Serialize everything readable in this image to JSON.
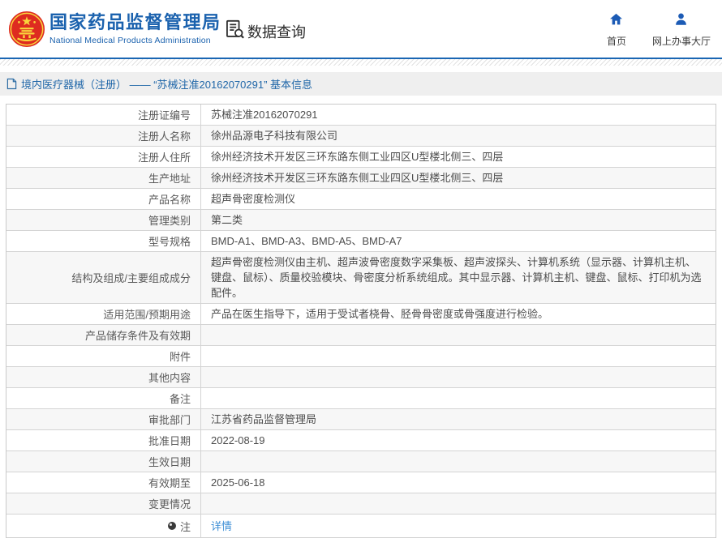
{
  "header": {
    "title_cn": "国家药品监督管理局",
    "title_en": "National Medical Products Administration",
    "section_label": "数据查询",
    "nav": [
      {
        "label": "首页",
        "icon": "home-icon"
      },
      {
        "label": "网上办事大厅",
        "icon": "user-icon"
      }
    ]
  },
  "breadcrumb": {
    "text": "境内医疗器械（注册） —— “苏械注准20162070291” 基本信息",
    "icon": "document-icon"
  },
  "table": {
    "rows": [
      {
        "label": "注册证编号",
        "value": "苏械注准20162070291"
      },
      {
        "label": "注册人名称",
        "value": "徐州品源电子科技有限公司"
      },
      {
        "label": "注册人住所",
        "value": "徐州经济技术开发区三环东路东侧工业四区U型楼北侧三、四层"
      },
      {
        "label": "生产地址",
        "value": "徐州经济技术开发区三环东路东侧工业四区U型楼北侧三、四层"
      },
      {
        "label": "产品名称",
        "value": "超声骨密度检测仪"
      },
      {
        "label": "管理类别",
        "value": "第二类"
      },
      {
        "label": "型号规格",
        "value": "BMD-A1、BMD-A3、BMD-A5、BMD-A7"
      },
      {
        "label": "结构及组成/主要组成成分",
        "value": "超声骨密度检测仪由主机、超声波骨密度数字采集板、超声波探头、计算机系统（显示器、计算机主机、键盘、鼠标）、质量校验模块、骨密度分析系统组成。其中显示器、计算机主机、键盘、鼠标、打印机为选配件。",
        "tall": true
      },
      {
        "label": "适用范围/预期用途",
        "value": "产品在医生指导下，适用于受试者桡骨、胫骨骨密度或骨强度进行检验。"
      },
      {
        "label": "产品储存条件及有效期",
        "value": ""
      },
      {
        "label": "附件",
        "value": ""
      },
      {
        "label": "其他内容",
        "value": ""
      },
      {
        "label": "备注",
        "value": ""
      },
      {
        "label": "审批部门",
        "value": "江苏省药品监督管理局"
      },
      {
        "label": "批准日期",
        "value": "2022-08-19"
      },
      {
        "label": "生效日期",
        "value": ""
      },
      {
        "label": "有效期至",
        "value": "2025-06-18"
      },
      {
        "label": "变更情况",
        "value": ""
      },
      {
        "label": "注",
        "value": "详情",
        "link": true,
        "icon": "bulb-icon",
        "note": true
      }
    ]
  },
  "colors": {
    "brand_blue": "#1b62ae",
    "nav_icon_blue": "#1c5bb5",
    "link_blue": "#3e8fd6",
    "divider_blue": "#1a66b3",
    "breadcrumb_bg": "#efefef",
    "row_alt_bg": "#f7f7f7",
    "emblem_red": "#de2b20",
    "emblem_gold": "#f9d53c"
  }
}
